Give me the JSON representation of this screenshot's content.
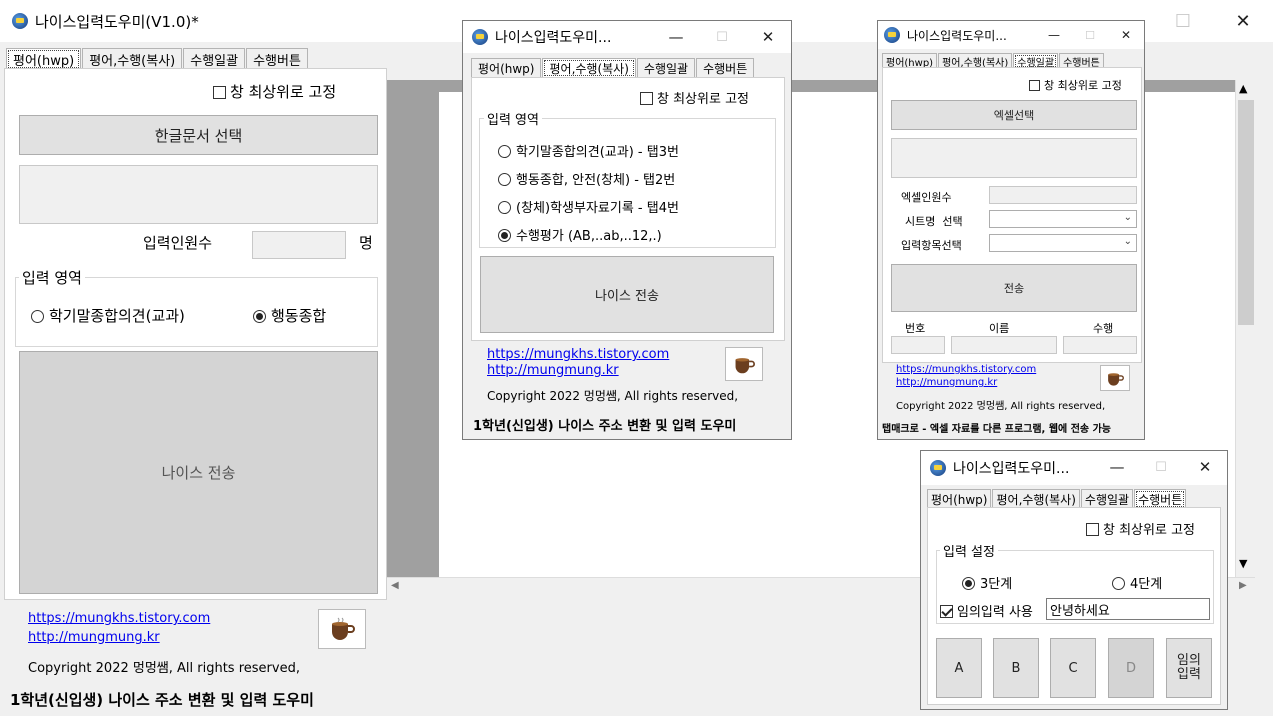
{
  "main": {
    "title": "나이스입력도우미(V1.0)*",
    "tabs": [
      "평어(hwp)",
      "평어,수행(복사)",
      "수행일괄",
      "수행버튼"
    ],
    "topmost_label": "창 최상위로 고정",
    "select_hwp_button": "한글문서 선택",
    "count_label": "입력인원수",
    "count_unit": "명",
    "group_title": "입력 영역",
    "radio_1": "학기말종합의견(교과)",
    "radio_2": "행동종합",
    "send_button": "나이스 전송",
    "link_1": "https://mungkhs.tistory.com",
    "link_2": "http://mungmung.kr",
    "copyright": "Copyright 2022 멍멍쌤, All rights reserved,",
    "footer": "1학년(신입생) 나이스 주소 변환 및 입력 도우미"
  },
  "win2": {
    "title": "나이스입력도우미...",
    "tabs": [
      "평어(hwp)",
      "평어,수행(복사)",
      "수행일괄",
      "수행버튼"
    ],
    "topmost_label": "창 최상위로 고정",
    "group_title": "입력 영역",
    "options": [
      "학기말종합의견(교과) - 탭3번",
      "행동종합, 안전(창체) - 탭2번",
      "(창체)학생부자료기록 - 탭4번",
      "수행평가 (AB,..ab,..12,.)"
    ],
    "send_button": "나이스 전송",
    "link_1": "https://mungkhs.tistory.com",
    "link_2": "http://mungmung.kr",
    "copyright": "Copyright 2022 멍멍쌤, All rights reserved,",
    "footer": "1학년(신입생) 나이스 주소 변환 및 입력 도우미"
  },
  "win3": {
    "title": "나이스입력도우미...",
    "tabs": [
      "평어(hwp)",
      "평어,수행(복사)",
      "수행일괄",
      "수행버튼"
    ],
    "topmost_label": "창 최상위로 고정",
    "excel_button": "엑셀선택",
    "excel_count_label": "엑셀인원수",
    "sheet_label": "시트명  선택",
    "item_label": "입력항목선택",
    "send_button": "전송",
    "col_number": "번호",
    "col_name": "이름",
    "col_perf": "수행",
    "link_1": "https://mungkhs.tistory.com",
    "link_2": "http://mungmung.kr",
    "copyright": "Copyright 2022 멍멍쌤, All rights reserved,",
    "footer": "탭매크로 - 엑셀 자료를 다른 프로그램, 웹에 전송 가능"
  },
  "win4": {
    "title": "나이스입력도우미...",
    "tabs": [
      "평어(hwp)",
      "평어,수행(복사)",
      "수행일괄",
      "수행버튼"
    ],
    "topmost_label": "창 최상위로 고정",
    "group_title": "입력 설정",
    "radio_3": "3단계",
    "radio_4": "4단계",
    "custom_label": "임의입력 사용",
    "custom_value": "안녕하세요",
    "buttons": [
      "A",
      "B",
      "C",
      "D"
    ],
    "custom_button": "임의\n입력"
  },
  "window_controls": {
    "minimize": "—",
    "maximize": "☐",
    "close": "✕"
  },
  "colors": {
    "link": "#0000ee",
    "button": "#e1e1e1",
    "big_button": "#d4d4d4",
    "doc_gray": "#a0a0a0"
  }
}
